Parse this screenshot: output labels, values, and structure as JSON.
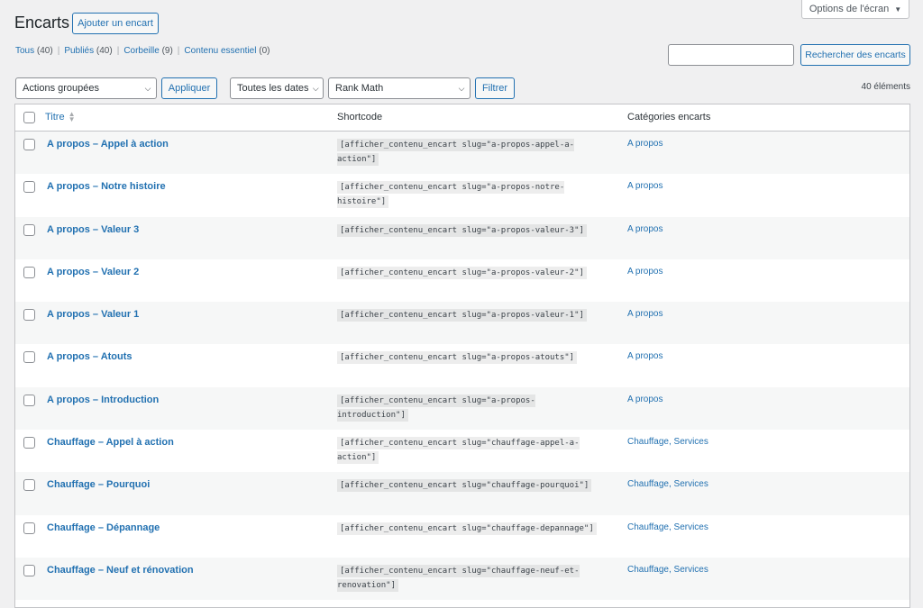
{
  "screen_options": {
    "label": "Options de l'écran",
    "caret": "▼"
  },
  "header": {
    "title": "Encarts",
    "add_new": "Ajouter un encart"
  },
  "views": [
    {
      "label": "Tous",
      "count": "(40)"
    },
    {
      "label": "Publiés",
      "count": "(40)"
    },
    {
      "label": "Corbeille",
      "count": "(9)"
    },
    {
      "label": "Contenu essentiel",
      "count": "(0)"
    }
  ],
  "search": {
    "value": "",
    "button": "Rechercher des encarts"
  },
  "toolbar": {
    "bulk": "Actions groupées",
    "apply": "Appliquer",
    "dates": "Toutes les dates",
    "rankmath": "Rank Math",
    "filter": "Filtrer",
    "count": "40 éléments"
  },
  "table": {
    "columns": {
      "title": "Titre",
      "shortcode": "Shortcode",
      "categories": "Catégories encarts"
    },
    "rows": [
      {
        "title": "A propos – Appel à action",
        "code": "[afficher_contenu_encart slug=\"a-propos-appel-a-action\"]",
        "cat": "A propos"
      },
      {
        "title": "A propos – Notre histoire",
        "code": "[afficher_contenu_encart slug=\"a-propos-notre-histoire\"]",
        "cat": "A propos"
      },
      {
        "title": "A propos – Valeur 3",
        "code": "[afficher_contenu_encart slug=\"a-propos-valeur-3\"]",
        "cat": "A propos"
      },
      {
        "title": "A propos – Valeur 2",
        "code": "[afficher_contenu_encart slug=\"a-propos-valeur-2\"]",
        "cat": "A propos"
      },
      {
        "title": "A propos – Valeur 1",
        "code": "[afficher_contenu_encart slug=\"a-propos-valeur-1\"]",
        "cat": "A propos"
      },
      {
        "title": "A propos – Atouts",
        "code": "[afficher_contenu_encart slug=\"a-propos-atouts\"]",
        "cat": "A propos"
      },
      {
        "title": "A propos – Introduction",
        "code": "[afficher_contenu_encart slug=\"a-propos-introduction\"]",
        "cat": "A propos"
      },
      {
        "title": "Chauffage – Appel à action",
        "code": "[afficher_contenu_encart slug=\"chauffage-appel-a-action\"]",
        "cat": "Chauffage, Services"
      },
      {
        "title": "Chauffage – Pourquoi",
        "code": "[afficher_contenu_encart slug=\"chauffage-pourquoi\"]",
        "cat": "Chauffage, Services"
      },
      {
        "title": "Chauffage – Dépannage",
        "code": "[afficher_contenu_encart slug=\"chauffage-depannage\"]",
        "cat": "Chauffage, Services"
      },
      {
        "title": "Chauffage – Neuf et rénovation",
        "code": "[afficher_contenu_encart slug=\"chauffage-neuf-et-renovation\"]",
        "cat": "Chauffage, Services"
      }
    ]
  }
}
